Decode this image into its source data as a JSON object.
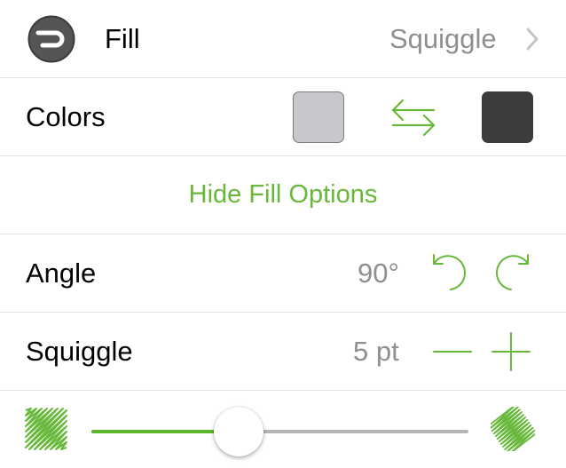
{
  "fill_row": {
    "label": "Fill",
    "value": "Squiggle",
    "icon": "fill-style-icon",
    "chevron_icon": "chevron-right-icon"
  },
  "colors_row": {
    "label": "Colors",
    "swatch_a": "#c8c7cc",
    "swatch_b": "#3c3c3c",
    "swap_icon": "swap-arrows-icon"
  },
  "hide_options": {
    "label": "Hide Fill Options"
  },
  "angle_row": {
    "label": "Angle",
    "value": "90°",
    "rotate_ccw_icon": "rotate-ccw-icon",
    "rotate_cw_icon": "rotate-cw-icon"
  },
  "squiggle_row": {
    "label": "Squiggle",
    "value": "5 pt",
    "decrease_icon": "minus-icon",
    "increase_icon": "plus-icon"
  },
  "density_slider": {
    "level": 0.39,
    "min_icon": "sparse-squiggle-icon",
    "max_icon": "dense-squiggle-icon"
  },
  "colors": {
    "accent": "#67b83a",
    "value_gray": "#8e8e93",
    "divider": "#e3e3e3"
  }
}
